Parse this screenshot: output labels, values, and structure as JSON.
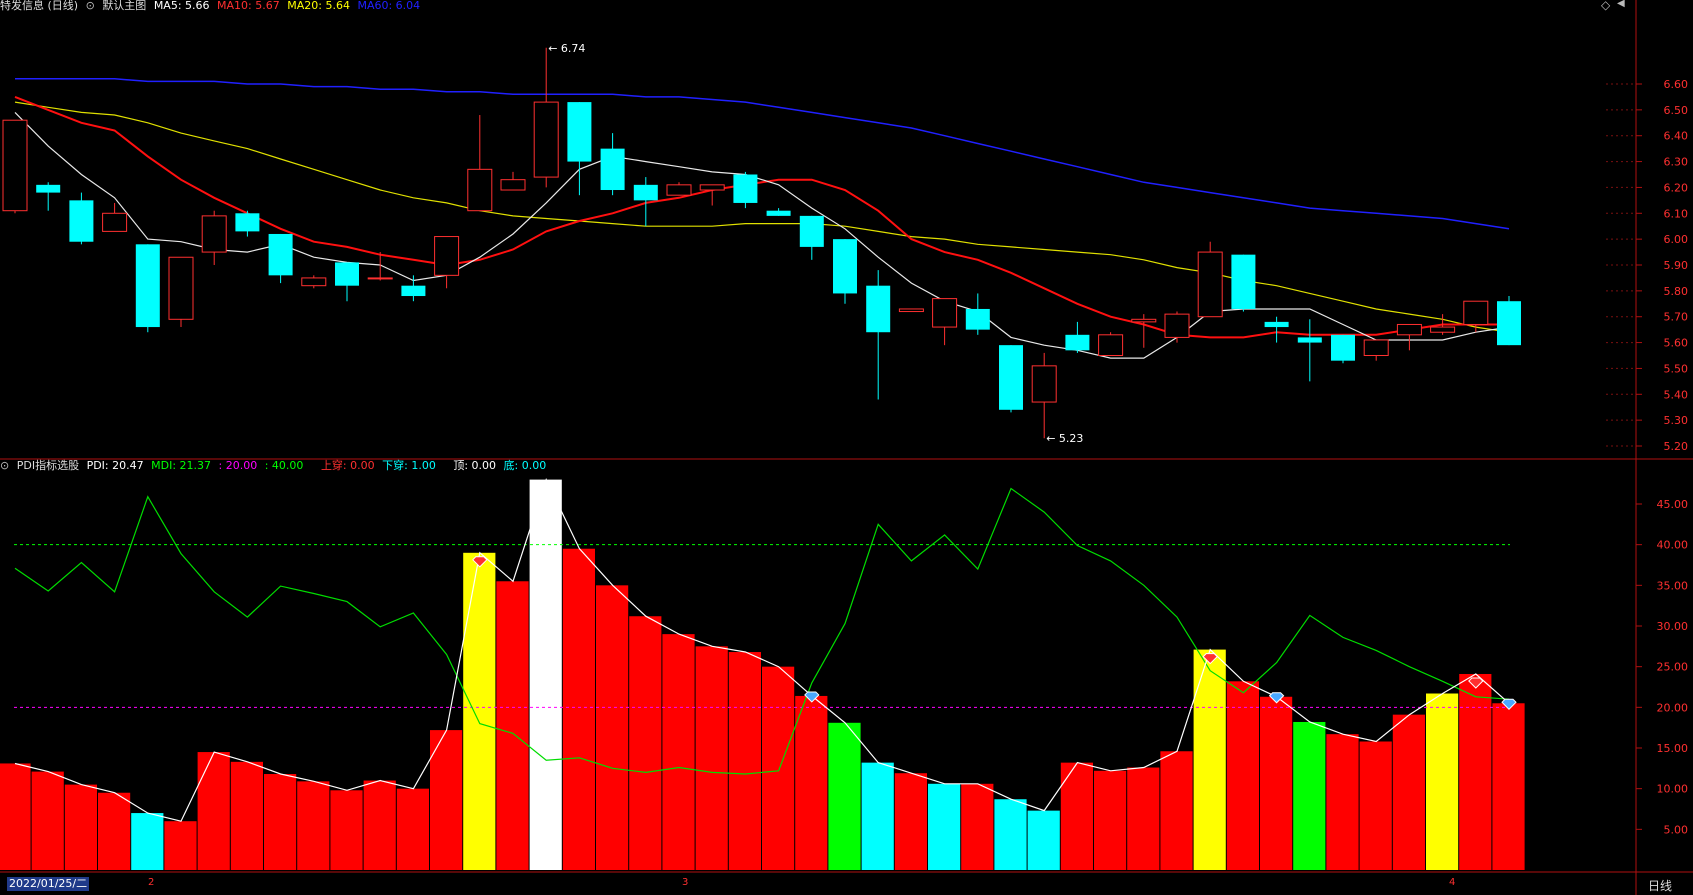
{
  "header_top": {
    "name": "特发信息 (日线)",
    "template": "默认主图",
    "ma": [
      {
        "label": "MA5: 5.66",
        "color": "#ffffff"
      },
      {
        "label": "MA10: 5.67",
        "color": "#ff3030"
      },
      {
        "label": "MA20: 5.64",
        "color": "#ffff00"
      },
      {
        "label": "MA60: 6.04",
        "color": "#2020ff"
      }
    ]
  },
  "header_bottom": {
    "name": "PDI指标选股",
    "items": [
      {
        "label": "PDI: 20.47",
        "color": "#ffffff"
      },
      {
        "label": "MDI: 21.37",
        "color": "#00ff00"
      },
      {
        "label": ": 20.00",
        "color": "#ff00ff"
      },
      {
        "label": ": 40.00",
        "color": "#00ff00"
      },
      {
        "label": "上穿: 0.00",
        "color": "#ff3030"
      },
      {
        "label": "下穿: 1.00",
        "color": "#00ffff"
      },
      {
        "label": "顶: 0.00",
        "color": "#ffffff"
      },
      {
        "label": "底: 0.00",
        "color": "#00ffff"
      }
    ]
  },
  "footer": {
    "date_label": "2022/01/25/二",
    "month_markers": [
      "2",
      "3",
      "4"
    ],
    "period_button": "日线"
  },
  "annotations": {
    "high_label": "6.74",
    "low_label": "5.23"
  },
  "chart_data": [
    {
      "type": "candlestick",
      "ylim": [
        5.15,
        6.74
      ],
      "y_ticks": [
        "5.20",
        "5.30",
        "5.40",
        "5.50",
        "5.60",
        "5.70",
        "5.80",
        "5.90",
        "6.00",
        "6.10",
        "6.20",
        "6.30",
        "6.40",
        "6.50",
        "6.60"
      ],
      "candles": [
        [
          6.11,
          6.46,
          6.1,
          6.46
        ],
        [
          6.21,
          6.18,
          6.11,
          6.22
        ],
        [
          6.15,
          5.99,
          5.98,
          6.18
        ],
        [
          6.03,
          6.1,
          6.03,
          6.14
        ],
        [
          5.98,
          5.66,
          5.64,
          5.98
        ],
        [
          5.69,
          5.93,
          5.66,
          5.93
        ],
        [
          5.95,
          6.09,
          5.9,
          6.11
        ],
        [
          6.1,
          6.03,
          6.01,
          6.11
        ],
        [
          6.02,
          5.86,
          5.83,
          6.02
        ],
        [
          5.82,
          5.85,
          5.81,
          5.86
        ],
        [
          5.91,
          5.82,
          5.76,
          5.91
        ],
        [
          5.85,
          5.85,
          5.84,
          5.95
        ],
        [
          5.82,
          5.78,
          5.76,
          5.86
        ],
        [
          5.86,
          6.01,
          5.81,
          6.01
        ],
        [
          6.11,
          6.27,
          6.11,
          6.48
        ],
        [
          6.19,
          6.23,
          6.19,
          6.26
        ],
        [
          6.24,
          6.53,
          6.2,
          6.74
        ],
        [
          6.53,
          6.3,
          6.17,
          6.53
        ],
        [
          6.35,
          6.19,
          6.17,
          6.41
        ],
        [
          6.21,
          6.15,
          6.05,
          6.24
        ],
        [
          6.17,
          6.21,
          6.17,
          6.22
        ],
        [
          6.19,
          6.21,
          6.13,
          6.21
        ],
        [
          6.25,
          6.14,
          6.12,
          6.26
        ],
        [
          6.11,
          6.09,
          6.09,
          6.12
        ],
        [
          6.09,
          5.97,
          5.92,
          6.09
        ],
        [
          6.0,
          5.79,
          5.75,
          6.0
        ],
        [
          5.82,
          5.64,
          5.38,
          5.88
        ],
        [
          5.72,
          5.73,
          5.72,
          5.73
        ],
        [
          5.66,
          5.77,
          5.59,
          5.77
        ],
        [
          5.73,
          5.65,
          5.63,
          5.79
        ],
        [
          5.59,
          5.34,
          5.33,
          5.59
        ],
        [
          5.37,
          5.51,
          5.23,
          5.56
        ],
        [
          5.63,
          5.57,
          5.56,
          5.68
        ],
        [
          5.55,
          5.63,
          5.55,
          5.64
        ],
        [
          5.68,
          5.69,
          5.58,
          5.71
        ],
        [
          5.62,
          5.71,
          5.6,
          5.72
        ],
        [
          5.7,
          5.95,
          5.7,
          5.99
        ],
        [
          5.94,
          5.73,
          5.72,
          5.94
        ],
        [
          5.68,
          5.66,
          5.6,
          5.7
        ],
        [
          5.62,
          5.6,
          5.45,
          5.69
        ],
        [
          5.63,
          5.53,
          5.52,
          5.63
        ],
        [
          5.55,
          5.61,
          5.53,
          5.61
        ],
        [
          5.63,
          5.67,
          5.57,
          5.67
        ],
        [
          5.64,
          5.66,
          5.63,
          5.71
        ],
        [
          5.67,
          5.76,
          5.64,
          5.76
        ],
        [
          5.76,
          5.59,
          5.59,
          5.78
        ]
      ],
      "ma5": [
        6.49,
        6.36,
        6.25,
        6.16,
        6.0,
        5.99,
        5.96,
        5.95,
        5.98,
        5.93,
        5.91,
        5.9,
        5.84,
        5.86,
        5.93,
        6.02,
        6.14,
        6.27,
        6.32,
        6.3,
        6.28,
        6.26,
        6.25,
        6.21,
        6.12,
        6.04,
        5.93,
        5.83,
        5.76,
        5.72,
        5.62,
        5.59,
        5.57,
        5.54,
        5.54,
        5.62,
        5.72,
        5.73,
        5.73,
        5.73,
        5.67,
        5.61,
        5.61,
        5.61,
        5.64,
        5.66
      ],
      "ma10": [
        6.55,
        6.5,
        6.45,
        6.42,
        6.32,
        6.23,
        6.16,
        6.1,
        6.04,
        5.99,
        5.97,
        5.94,
        5.92,
        5.9,
        5.92,
        5.96,
        6.03,
        6.07,
        6.1,
        6.14,
        6.16,
        6.19,
        6.21,
        6.23,
        6.23,
        6.19,
        6.11,
        6.0,
        5.95,
        5.92,
        5.87,
        5.81,
        5.75,
        5.7,
        5.67,
        5.63,
        5.62,
        5.62,
        5.64,
        5.63,
        5.63,
        5.63,
        5.65,
        5.67,
        5.67,
        5.67
      ],
      "ma20": [
        6.53,
        6.51,
        6.49,
        6.48,
        6.45,
        6.41,
        6.38,
        6.35,
        6.31,
        6.27,
        6.23,
        6.19,
        6.16,
        6.14,
        6.11,
        6.09,
        6.08,
        6.07,
        6.06,
        6.05,
        6.05,
        6.05,
        6.06,
        6.06,
        6.06,
        6.05,
        6.03,
        6.01,
        6.0,
        5.98,
        5.97,
        5.96,
        5.95,
        5.94,
        5.92,
        5.89,
        5.87,
        5.84,
        5.82,
        5.79,
        5.76,
        5.73,
        5.71,
        5.69,
        5.66,
        5.64
      ],
      "ma60": [
        6.62,
        6.62,
        6.62,
        6.62,
        6.61,
        6.61,
        6.61,
        6.6,
        6.6,
        6.59,
        6.59,
        6.58,
        6.58,
        6.57,
        6.57,
        6.56,
        6.56,
        6.56,
        6.56,
        6.55,
        6.55,
        6.54,
        6.53,
        6.51,
        6.49,
        6.47,
        6.45,
        6.43,
        6.4,
        6.37,
        6.34,
        6.31,
        6.28,
        6.25,
        6.22,
        6.2,
        6.18,
        6.16,
        6.14,
        6.12,
        6.11,
        6.1,
        6.09,
        6.08,
        6.06,
        6.04
      ]
    },
    {
      "type": "bar",
      "ylim": [
        0,
        48
      ],
      "y_ticks": [
        "5.00",
        "10.00",
        "15.00",
        "20.00",
        "25.00",
        "30.00",
        "35.00",
        "40.00",
        "45.00"
      ],
      "levels": [
        20,
        40
      ],
      "pdi": [
        13.1,
        12.1,
        10.5,
        9.5,
        7.0,
        6.0,
        14.5,
        13.3,
        11.8,
        10.9,
        9.8,
        11.0,
        10.0,
        17.2,
        39.0,
        35.5,
        48.0,
        39.5,
        35.0,
        31.2,
        29.0,
        27.5,
        26.8,
        25.0,
        21.4,
        18.1,
        13.2,
        11.9,
        10.6,
        10.6,
        8.7,
        7.3,
        13.2,
        12.2,
        12.6,
        14.6,
        27.1,
        23.2,
        21.3,
        18.2,
        16.7,
        15.8,
        19.1,
        21.7,
        24.1,
        20.5
      ],
      "mdi": [
        37.1,
        34.3,
        37.8,
        34.2,
        45.9,
        38.9,
        34.2,
        31.1,
        34.9,
        34.0,
        33.0,
        29.9,
        31.6,
        26.5,
        18.0,
        16.8,
        13.5,
        13.8,
        12.5,
        12.0,
        12.6,
        12.0,
        11.8,
        12.2,
        23.0,
        30.3,
        42.5,
        38.0,
        41.2,
        37.0,
        46.9,
        44.0,
        39.9,
        38.0,
        35.0,
        31.1,
        24.5,
        21.8,
        25.5,
        31.3,
        28.6,
        27.0,
        25.0,
        23.2,
        21.3,
        21.0
      ],
      "bar_colors": [
        "red",
        "red",
        "red",
        "red",
        "cyan",
        "red",
        "red",
        "red",
        "red",
        "red",
        "red",
        "red",
        "red",
        "red",
        "yellow",
        "red",
        "white",
        "red",
        "red",
        "red",
        "red",
        "red",
        "red",
        "red",
        "red",
        "green",
        "cyan",
        "red",
        "cyan",
        "red",
        "cyan",
        "cyan",
        "red",
        "red",
        "red",
        "red",
        "yellow",
        "red",
        "red",
        "green",
        "red",
        "red",
        "red",
        "yellow",
        "red",
        "red"
      ],
      "top_markers": [
        14,
        36,
        44
      ],
      "bottom_markers": [
        24,
        38,
        45
      ]
    }
  ]
}
